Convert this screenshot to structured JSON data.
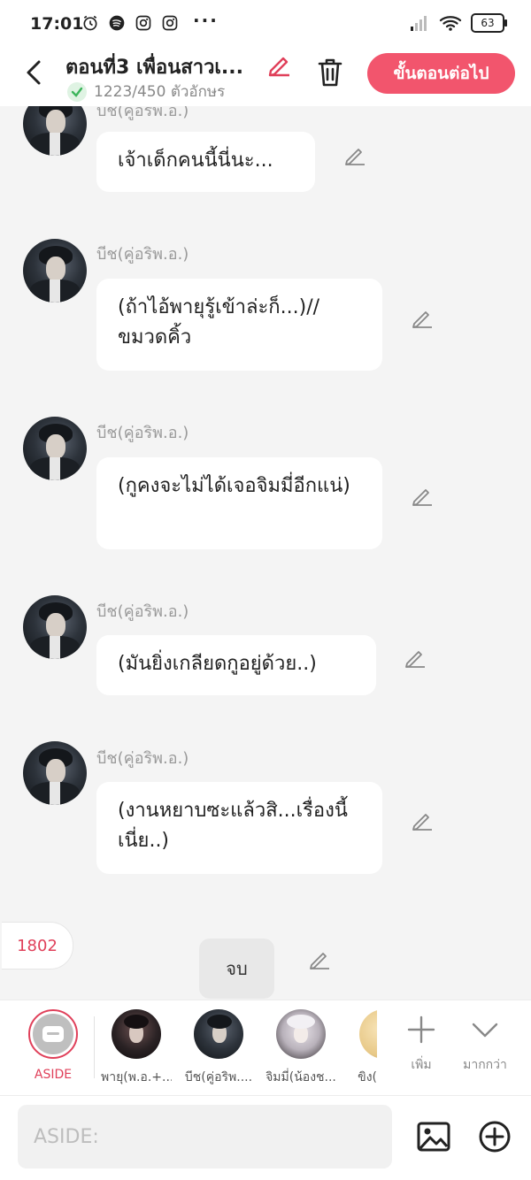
{
  "status": {
    "time": "17:01",
    "battery": "63"
  },
  "header": {
    "title": "ตอนที่3 เพื่อนสาวเ...",
    "char_count": "1223/450 ตัวอักษร",
    "next_label": "ขั้นตอนต่อไป"
  },
  "messages": [
    {
      "sender": "บีช(คู่อริพ.อ.)",
      "text": "เจ้าเด็กคนนี้นี่นะ..."
    },
    {
      "sender": "บีช(คู่อริพ.อ.)",
      "text": "(ถ้าไอ้พายุรู้เข้าล่ะก็...)// ขมวดคิ้ว"
    },
    {
      "sender": "บีช(คู่อริพ.อ.)",
      "text": "(กูคงจะไม่ได้เจอจิมมี่อีกแน่)"
    },
    {
      "sender": "บีช(คู่อริพ.อ.)",
      "text": "(มันยิ่งเกลียดกูอยู่ด้วย..)"
    },
    {
      "sender": "บีช(คู่อริพ.อ.)",
      "text": "(งานหยาบซะแล้วสิ...เรื่องนี้เนี่ย..)"
    }
  ],
  "end_count": "1802",
  "end_label": "จบ",
  "characters": [
    {
      "name": "ASIDE"
    },
    {
      "name": "พายุ(พ.อ.+..."
    },
    {
      "name": "บีช(คู่อริพ...."
    },
    {
      "name": "จิมมี่(น้องช..."
    },
    {
      "name": "ขิง("
    }
  ],
  "tools": {
    "add_label": "เพิ่ม",
    "more_label": "มากกว่า"
  },
  "input": {
    "placeholder": "ASIDE:"
  },
  "colors": {
    "accent": "#f2556d",
    "aside": "#e0405a"
  }
}
